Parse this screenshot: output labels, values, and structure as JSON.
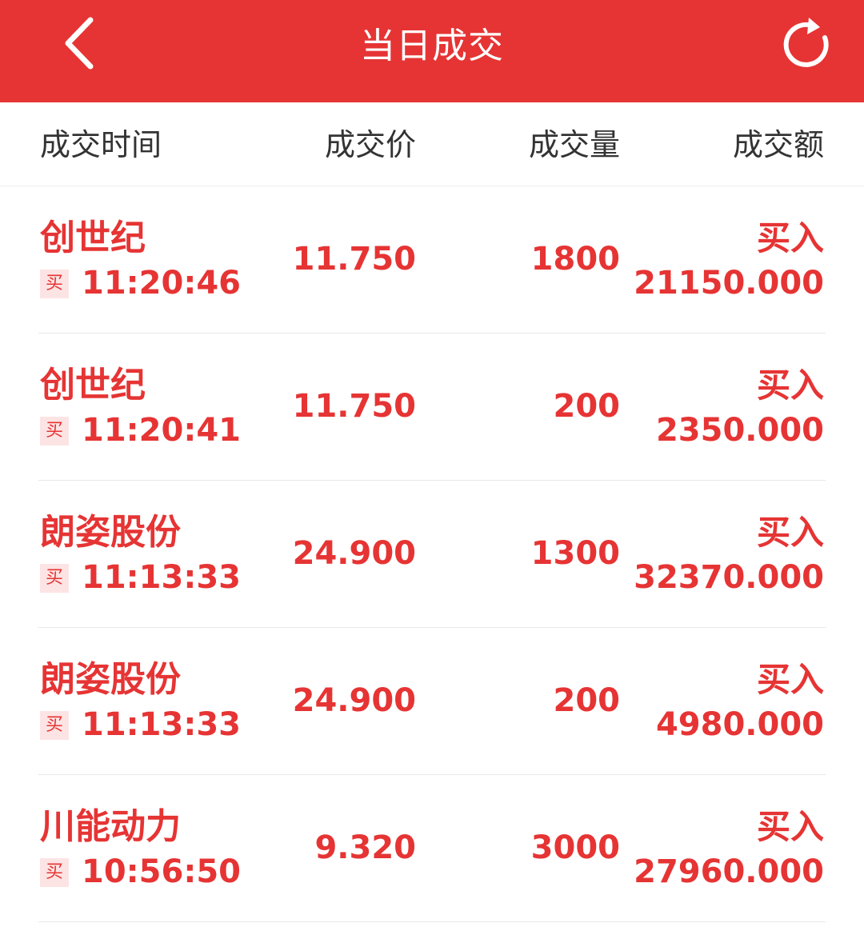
{
  "header": {
    "title": "当日成交",
    "back_icon": "chevron-left-icon",
    "refresh_icon": "refresh-icon",
    "bg_color": "#e63434"
  },
  "columns": {
    "time": "成交时间",
    "price": "成交价",
    "volume": "成交量",
    "amount": "成交额"
  },
  "trades": [
    {
      "name": "创世纪",
      "side_badge": "买",
      "time": "11:20:46",
      "price": "11.750",
      "volume": "1800",
      "direction": "买入",
      "amount": "21150.000"
    },
    {
      "name": "创世纪",
      "side_badge": "买",
      "time": "11:20:41",
      "price": "11.750",
      "volume": "200",
      "direction": "买入",
      "amount": "2350.000"
    },
    {
      "name": "朗姿股份",
      "side_badge": "买",
      "time": "11:13:33",
      "price": "24.900",
      "volume": "1300",
      "direction": "买入",
      "amount": "32370.000"
    },
    {
      "name": "朗姿股份",
      "side_badge": "买",
      "time": "11:13:33",
      "price": "24.900",
      "volume": "200",
      "direction": "买入",
      "amount": "4980.000"
    },
    {
      "name": "川能动力",
      "side_badge": "买",
      "time": "10:56:50",
      "price": "9.320",
      "volume": "3000",
      "direction": "买入",
      "amount": "27960.000"
    }
  ],
  "colors": {
    "accent": "#e63434",
    "badge_bg": "#fde4e4"
  }
}
